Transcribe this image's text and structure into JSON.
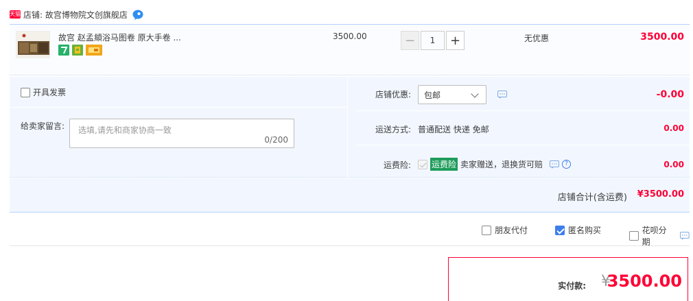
{
  "shop": {
    "badge": "天猫",
    "name": "店铺: 故宫博物院文创旗舰店",
    "contact_icon": "chat-bubble-icon"
  },
  "item": {
    "thumb_icon": "product-thumbnail-icon",
    "title": "故宫 赵孟頫浴马图卷 原大手卷 ...",
    "service_icons": [
      "seven-day-return-icon",
      "shopping-bag-icon",
      "credit-card-icon"
    ],
    "unit_price": "3500.00",
    "quantity": "1",
    "qty_minus": "−",
    "qty_plus": "+",
    "discount": "无优惠",
    "total": "3500.00"
  },
  "invoice": {
    "label": "开具发票"
  },
  "memo": {
    "label": "给卖家留言:",
    "placeholder": "选填,请先和商家协商一致",
    "count": "0/200"
  },
  "shop_discount": {
    "label": "店铺优惠:",
    "selected": "包邮",
    "amount": "-0.00"
  },
  "shipping": {
    "label": "运送方式:",
    "value": "普通配送 快递 免邮",
    "amount": "0.00"
  },
  "insurance": {
    "label": "运费险:",
    "tag": "运费险",
    "text": "卖家赠送，退换货可赔",
    "amount": "0.00"
  },
  "shop_total": {
    "label": "店铺合计(含运费)",
    "value": "¥3500.00"
  },
  "extras": {
    "friend_pay": {
      "label": "朋友代付",
      "checked": false
    },
    "anonymous": {
      "label": "匿名购买",
      "checked": true
    },
    "huabei": {
      "label": "花呗分期",
      "checked": false
    }
  },
  "payment": {
    "label": "实付款:",
    "currency": "¥",
    "amount": "3500.00"
  },
  "colors": {
    "accent_red": "#ff0036",
    "row_bg": "#f2f7ff",
    "border_blue": "#b2d1ff",
    "check_blue": "#3d7eea",
    "insurance_green": "#1e9c5a"
  }
}
